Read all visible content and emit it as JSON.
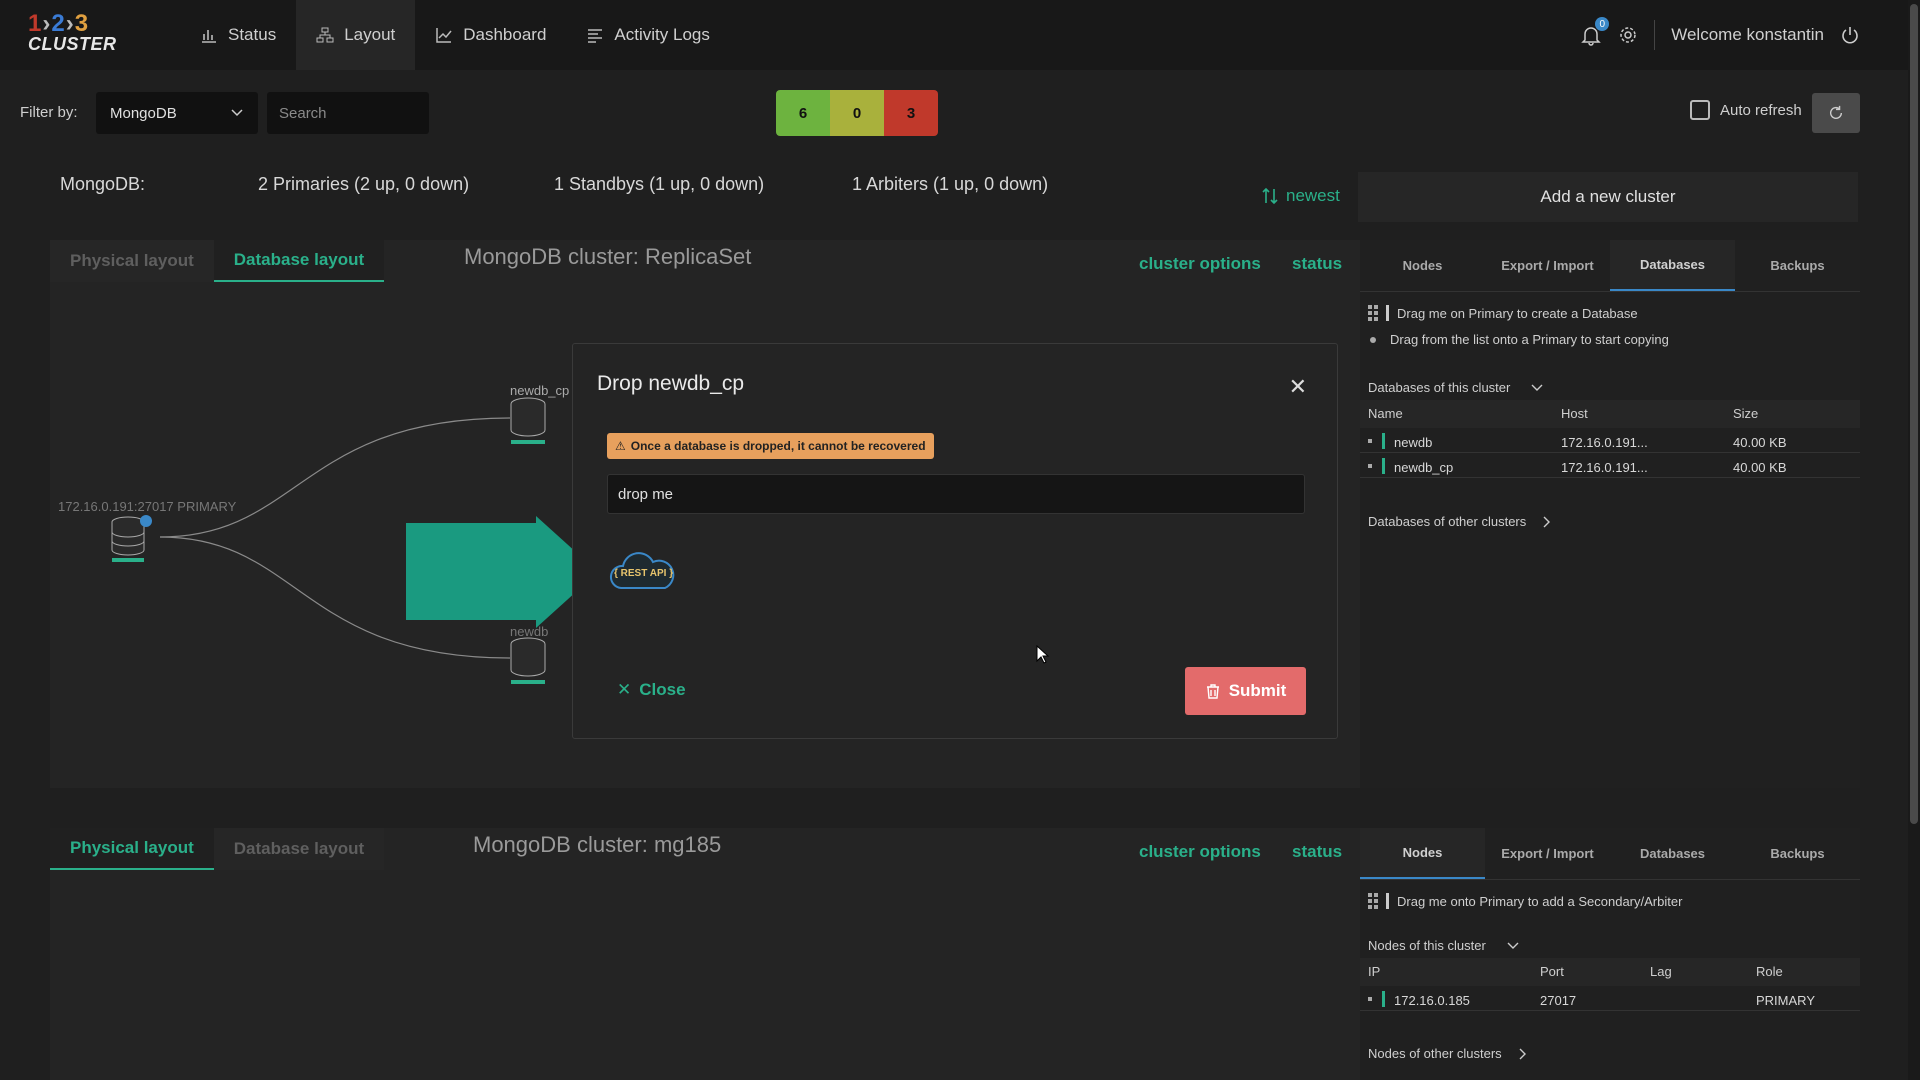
{
  "brand": {
    "n1": "1",
    "n2": "2",
    "n3": "3",
    "word": "CLUSTER"
  },
  "nav": [
    {
      "label": "Status",
      "icon": "bar-chart-icon"
    },
    {
      "label": "Layout",
      "icon": "network-icon"
    },
    {
      "label": "Dashboard",
      "icon": "line-chart-icon"
    },
    {
      "label": "Activity Logs",
      "icon": "list-icon"
    }
  ],
  "header": {
    "notifications": "0",
    "welcome": "Welcome konstantin"
  },
  "filter": {
    "label": "Filter by:",
    "selected": "MongoDB",
    "search_placeholder": "Search"
  },
  "counts": {
    "green": "6",
    "yellow": "0",
    "red": "3"
  },
  "auto_refresh": {
    "label": "Auto refresh",
    "checked": false
  },
  "summary": {
    "type": "MongoDB:",
    "primaries": "2 Primaries (2 up, 0 down)",
    "standbys": "1 Standbys (1 up, 0 down)",
    "arbiters": "1 Arbiters (1 up, 0 down)",
    "sort": "newest",
    "add_cluster": "Add a new cluster"
  },
  "cluster1": {
    "tabs": [
      "Physical layout",
      "Database layout"
    ],
    "title": "MongoDB cluster: ReplicaSet",
    "options": "cluster options",
    "status": "status",
    "primary_label": "172.16.0.191:27017 PRIMARY",
    "db_top": "newdb_cp",
    "db_bottom": "newdb",
    "side_tabs": [
      "Nodes",
      "Export / Import",
      "Databases",
      "Backups"
    ],
    "hint1": "Drag me on Primary to create a Database",
    "hint2": "Drag from the list onto a Primary to start copying",
    "dbs_this": "Databases of this cluster",
    "dbs_other": "Databases of other clusters",
    "columns": [
      "Name",
      "Host",
      "Size"
    ],
    "rows": [
      {
        "name": "newdb",
        "host": "172.16.0.191...",
        "size": "40.00 KB"
      },
      {
        "name": "newdb_cp",
        "host": "172.16.0.191...",
        "size": "40.00 KB"
      }
    ]
  },
  "cluster2": {
    "tabs": [
      "Physical layout",
      "Database layout"
    ],
    "title": "MongoDB cluster: mg185",
    "options": "cluster options",
    "status": "status",
    "side_tabs": [
      "Nodes",
      "Export / Import",
      "Databases",
      "Backups"
    ],
    "hint1": "Drag me onto Primary to add a Secondary/Arbiter",
    "nodes_this": "Nodes of this cluster",
    "nodes_other": "Nodes of other clusters",
    "columns": [
      "IP",
      "Port",
      "Lag",
      "Role"
    ],
    "rows": [
      {
        "ip": "172.16.0.185",
        "port": "27017",
        "lag": "",
        "role": "PRIMARY"
      }
    ]
  },
  "modal": {
    "title": "Drop newdb_cp",
    "warning": "Once a database is dropped, it cannot be recovered",
    "confirm_value": "drop me",
    "rest_api": "{ REST API }",
    "close": "Close",
    "submit": "Submit"
  },
  "colors": {
    "accent": "#2ab08a",
    "danger": "#e36b6b",
    "warning": "#e7a05d",
    "arrow": "#1a9a80"
  }
}
